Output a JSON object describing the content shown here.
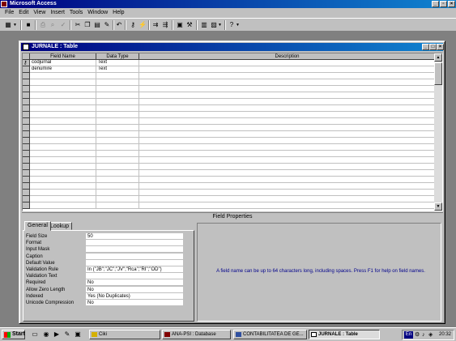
{
  "app": {
    "title": "Microsoft Access"
  },
  "menu": [
    "File",
    "Edit",
    "View",
    "Insert",
    "Tools",
    "Window",
    "Help"
  ],
  "child_window": {
    "title": "JURNALE : Table"
  },
  "grid": {
    "columns": [
      "Field Name",
      "Data Type",
      "Description"
    ],
    "rows": [
      {
        "field_name": "codjurnal",
        "data_type": "Text",
        "description": "",
        "primary_key": true
      },
      {
        "field_name": "denumire",
        "data_type": "Text",
        "description": "",
        "primary_key": false
      }
    ]
  },
  "field_properties": {
    "header": "Field Properties",
    "tabs": [
      "General",
      "Lookup"
    ],
    "active_tab": "General",
    "properties": [
      {
        "label": "Field Size",
        "value": "50"
      },
      {
        "label": "Format",
        "value": ""
      },
      {
        "label": "Input Mask",
        "value": ""
      },
      {
        "label": "Caption",
        "value": ""
      },
      {
        "label": "Default Value",
        "value": ""
      },
      {
        "label": "Validation Rule",
        "value": "In (\"JB\";\"JC\";\"JV\";\"Rca\";\"RI\";\"OD\")"
      },
      {
        "label": "Validation Text",
        "value": ""
      },
      {
        "label": "Required",
        "value": "No"
      },
      {
        "label": "Allow Zero Length",
        "value": "No"
      },
      {
        "label": "Indexed",
        "value": "Yes (No Duplicates)"
      },
      {
        "label": "Unicode Compression",
        "value": "No"
      }
    ],
    "help_text": "A field name can be up to 64 characters long, including spaces.  Press F1 for help on field names."
  },
  "taskbar": {
    "start_label": "Start",
    "tasks": [
      {
        "label": "Ciki",
        "active": false
      },
      {
        "label": "ANA-PSI : Database",
        "active": false
      },
      {
        "label": "CONTABILITATEA DE GE...",
        "active": false
      },
      {
        "label": "JURNALE : Table",
        "active": true
      }
    ],
    "language": "En",
    "clock": "20:32"
  },
  "colors": {
    "titlebar": "#000080",
    "face": "#c0c0c0",
    "desktop_bg": "#808080",
    "help_text": "#00008b"
  }
}
